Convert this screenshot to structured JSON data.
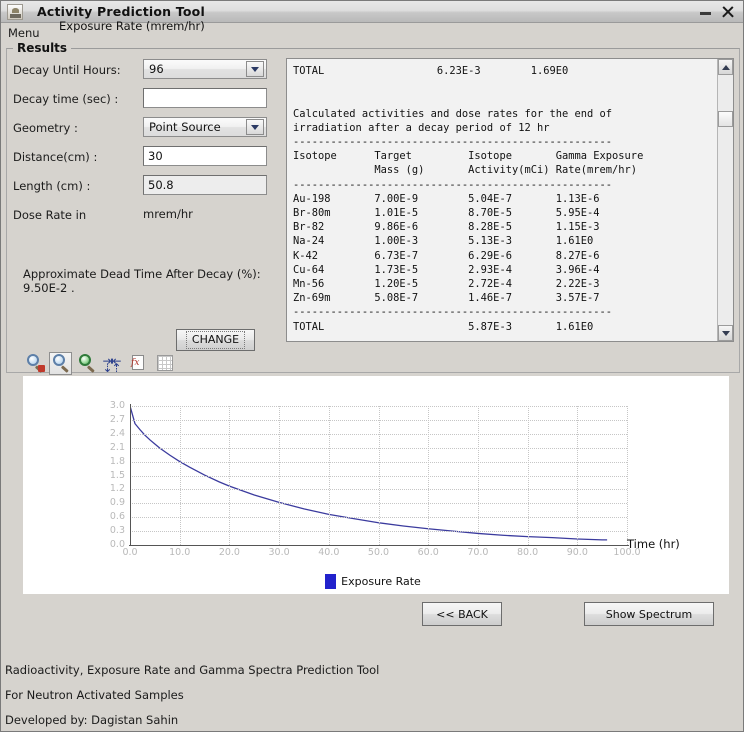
{
  "window": {
    "title": "Activity Prediction Tool",
    "app_icon": "app-icon",
    "minimize_label": "–",
    "close_label": "✕"
  },
  "menubar": {
    "items": [
      {
        "label": "Menu"
      }
    ]
  },
  "results_panel": {
    "legend": "Results"
  },
  "form": {
    "fields": [
      {
        "label": "Decay Until Hours:",
        "type": "combo",
        "value": "96"
      },
      {
        "label": "Decay time (sec) :",
        "type": "text",
        "value": ""
      },
      {
        "label": "Geometry :",
        "type": "combo",
        "value": "Point Source"
      },
      {
        "label": "Distance(cm) :",
        "type": "text",
        "value": "30"
      },
      {
        "label": "Length (cm) :",
        "type": "text",
        "value": "50.8"
      },
      {
        "label": "Dose Rate in",
        "type": "static",
        "value": "mrem/hr"
      }
    ],
    "dead_time_note": "Approximate Dead Time After Decay (%): 9.50E-2 .",
    "change_button": "CHANGE"
  },
  "results_text": "TOTAL                  6.23E-3        1.69E0\n\n\nCalculated activities and dose rates for the end of\nirradiation after a decay period of 12 hr\n---------------------------------------------------\nIsotope      Target         Isotope       Gamma Exposure\n             Mass (g)       Activity(mCi) Rate(mrem/hr)\n---------------------------------------------------\nAu-198       7.00E-9        5.04E-7       1.13E-6\nBr-80m       1.01E-5        8.70E-5       5.95E-4\nBr-82        9.86E-6        8.28E-5       1.15E-3\nNa-24        1.00E-3        5.13E-3       1.61E0\nK-42         6.73E-7        6.29E-6       8.27E-6\nCu-64        1.73E-5        2.93E-4       3.96E-4\nMn-56        1.20E-5        2.72E-4       2.22E-3\nZn-69m       5.08E-7        1.46E-7       3.57E-7\n---------------------------------------------------\nTOTAL                       5.87E-3       1.61E0\n",
  "scrollbar": {
    "up_arrow": "scroll-up-icon",
    "down_arrow": "scroll-down-icon"
  },
  "chart_toolbar": {
    "buttons": [
      {
        "name": "zoom-out-icon",
        "tooltip": "Zoom Out"
      },
      {
        "name": "zoom-in-icon",
        "tooltip": "Zoom In",
        "selected": true
      },
      {
        "name": "zoom-fit-icon",
        "tooltip": "Auto Scale"
      },
      {
        "name": "fit-width-icon",
        "tooltip": "Fit Width"
      },
      {
        "name": "function-editor-icon",
        "tooltip": "Edit Function"
      },
      {
        "name": "grid-toggle-icon",
        "tooltip": "Toggle Grid"
      }
    ]
  },
  "chart_data": {
    "type": "line",
    "title": "Exposure Rate (mrem/hr)",
    "xlabel": "Time (hr)",
    "ylabel": "Exposure Rate (mrem/hr)",
    "xlim": [
      0.0,
      100.0
    ],
    "ylim": [
      0.0,
      3.0
    ],
    "grid": true,
    "legend_position": "bottom",
    "xticks": [
      "0.0",
      "10.0",
      "20.0",
      "30.0",
      "40.0",
      "50.0",
      "60.0",
      "70.0",
      "80.0",
      "90.0",
      "100.0"
    ],
    "yticks": [
      "0.0",
      "0.3",
      "0.6",
      "0.9",
      "1.2",
      "1.5",
      "1.8",
      "2.1",
      "2.4",
      "2.7",
      "3.0"
    ],
    "series": [
      {
        "name": "Exposure Rate",
        "color": "#3b3b9e",
        "x": [
          0,
          1,
          2,
          3,
          4,
          5,
          6,
          8,
          10,
          12,
          15,
          18,
          20,
          25,
          30,
          35,
          40,
          45,
          50,
          55,
          60,
          65,
          70,
          75,
          80,
          85,
          90,
          95,
          96
        ],
        "y": [
          3.0,
          2.62,
          2.49,
          2.37,
          2.27,
          2.18,
          2.09,
          1.94,
          1.8,
          1.68,
          1.51,
          1.36,
          1.27,
          1.08,
          0.92,
          0.78,
          0.66,
          0.57,
          0.48,
          0.41,
          0.35,
          0.3,
          0.25,
          0.21,
          0.18,
          0.16,
          0.13,
          0.11,
          0.11
        ]
      }
    ]
  },
  "legend": {
    "swatch_color": "#2222cc",
    "label": "Exposure Rate"
  },
  "buttons": {
    "back": "<< BACK",
    "spectrum": "Show Spectrum"
  },
  "footer": {
    "line1": "Radioactivity, Exposure Rate and Gamma Spectra Prediction Tool",
    "line2": "For Neutron Activated Samples",
    "line3": "Developed by: Dagistan Sahin"
  }
}
